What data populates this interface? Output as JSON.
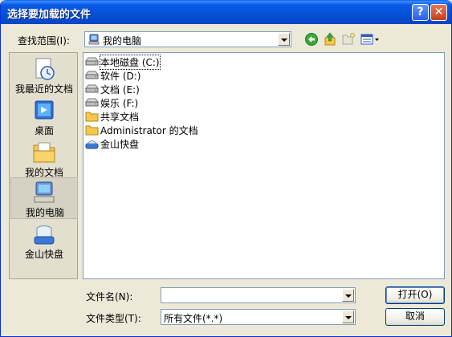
{
  "window": {
    "title": "选择要加载的文件",
    "help_icon": "?",
    "close_icon": "✕"
  },
  "lookin": {
    "label": "查找范围(I):",
    "value": "我的电脑"
  },
  "places": [
    {
      "label": "我最近的文档",
      "icon": "recent-docs-icon"
    },
    {
      "label": "桌面",
      "icon": "desktop-icon"
    },
    {
      "label": "我的文档",
      "icon": "my-documents-icon"
    },
    {
      "label": "我的电脑",
      "icon": "my-computer-icon",
      "selected": true
    },
    {
      "label": "金山快盘",
      "icon": "kuaipan-icon"
    }
  ],
  "files": [
    {
      "name": "本地磁盘 (C:)",
      "icon": "drive-icon"
    },
    {
      "name": "软件 (D:)",
      "icon": "drive-icon"
    },
    {
      "name": "文档 (E:)",
      "icon": "drive-icon"
    },
    {
      "name": "娱乐 (F:)",
      "icon": "drive-icon"
    },
    {
      "name": "共享文档",
      "icon": "folder-icon"
    },
    {
      "name": "Administrator 的文档",
      "icon": "folder-icon"
    },
    {
      "name": "金山快盘",
      "icon": "kuaipan-icon"
    }
  ],
  "filename": {
    "label": "文件名(N):",
    "value": ""
  },
  "filetype": {
    "label": "文件类型(T):",
    "value": "所有文件(*.*)"
  },
  "buttons": {
    "open": "打开(O)",
    "cancel": "取消"
  }
}
